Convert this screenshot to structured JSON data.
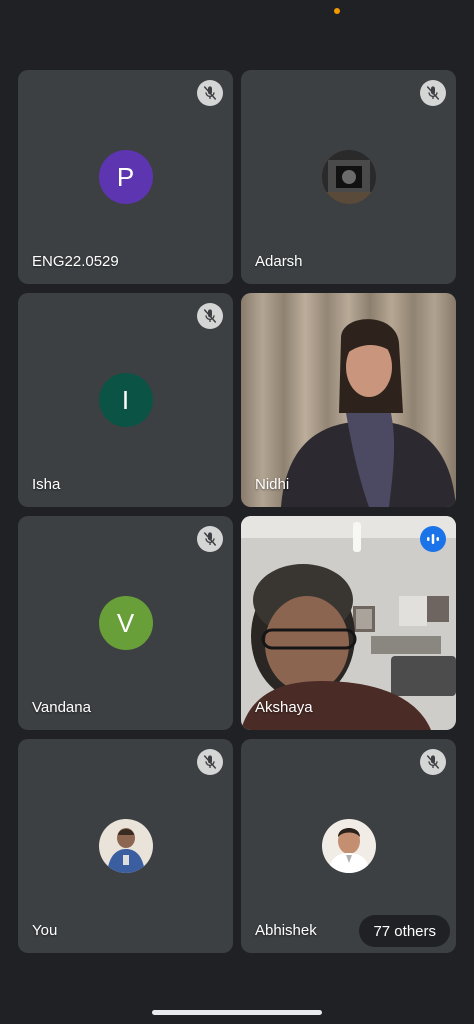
{
  "status": {
    "indicator_color": "#f29900"
  },
  "participants": [
    {
      "name": "ENG22.0529",
      "avatar_initial": "P",
      "avatar_color": "#5e35b1",
      "muted": true
    },
    {
      "name": "Adarsh",
      "avatar_photo": "profile-photo",
      "muted": true
    },
    {
      "name": "Isha",
      "avatar_initial": "I",
      "avatar_color": "#0b5345",
      "muted": true
    },
    {
      "name": "Nidhi",
      "video": "camera-feed",
      "muted": false
    },
    {
      "name": "Vandana",
      "avatar_initial": "V",
      "avatar_color": "#689f38",
      "muted": true
    },
    {
      "name": "Akshaya",
      "video": "camera-feed",
      "speaking": true,
      "muted": false
    },
    {
      "name": "You",
      "avatar_photo": "profile-photo",
      "muted": true
    },
    {
      "name": "Abhishek",
      "avatar_photo": "profile-photo",
      "muted": true
    }
  ],
  "others_chip": {
    "label": "77 others"
  },
  "icons": {
    "mute": "mic-off-icon",
    "speaking": "speaking-indicator-icon"
  }
}
